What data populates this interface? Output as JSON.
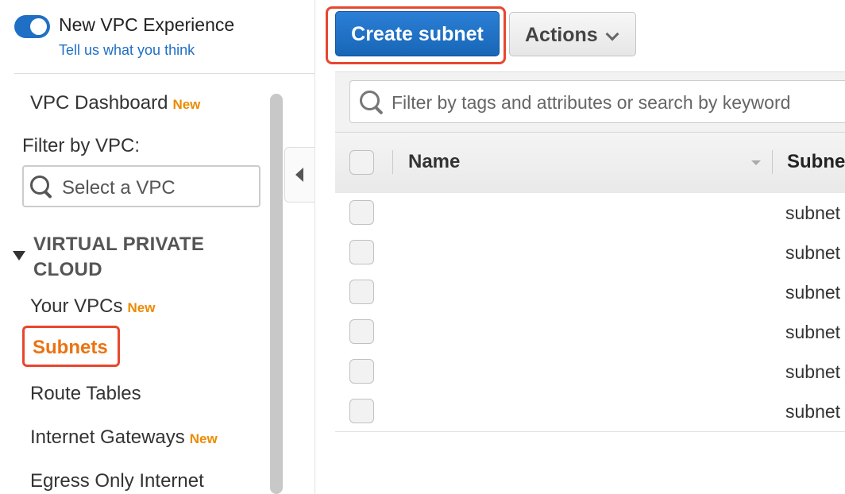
{
  "sidebar": {
    "experience_title": "New VPC Experience",
    "experience_link": "Tell us what you think",
    "dashboard_label": "VPC Dashboard",
    "new_badge": "New",
    "filter_label": "Filter by VPC:",
    "vpc_placeholder": "Select a VPC",
    "section_title": "VIRTUAL PRIVATE CLOUD",
    "items": [
      {
        "label": "Your VPCs",
        "badge": "New"
      },
      {
        "label": "Subnets"
      },
      {
        "label": "Route Tables"
      },
      {
        "label": "Internet Gateways",
        "badge": "New"
      },
      {
        "label": "Egress Only Internet"
      }
    ]
  },
  "toolbar": {
    "create_label": "Create subnet",
    "actions_label": "Actions"
  },
  "search": {
    "placeholder": "Filter by tags and attributes or search by keyword"
  },
  "table": {
    "columns": [
      "Name",
      "Subne"
    ],
    "rows": [
      {
        "name": "",
        "subnet": "subnet"
      },
      {
        "name": "",
        "subnet": "subnet"
      },
      {
        "name": "",
        "subnet": "subnet"
      },
      {
        "name": "",
        "subnet": "subnet"
      },
      {
        "name": "",
        "subnet": "subnet"
      },
      {
        "name": "",
        "subnet": "subnet"
      }
    ]
  },
  "colors": {
    "primary": "#1f6fc5",
    "highlight": "#e7472e",
    "new_badge": "#ec8b00",
    "active_nav": "#ec7211"
  }
}
